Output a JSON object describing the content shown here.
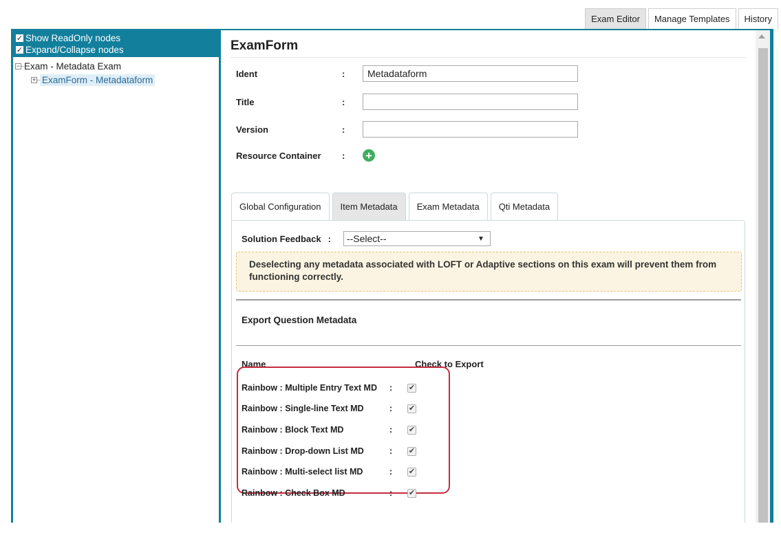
{
  "top_tabs": [
    {
      "label": "Exam Editor",
      "active": true
    },
    {
      "label": "Manage Templates",
      "active": false
    },
    {
      "label": "History",
      "active": false
    }
  ],
  "tree": {
    "options": [
      {
        "label": "Show ReadOnly nodes",
        "checked": true
      },
      {
        "label": "Expand/Collapse nodes",
        "checked": true
      }
    ],
    "nodes": [
      {
        "label": "Exam - Metadata Exam",
        "expander": "−"
      },
      {
        "label": "ExamForm - Metadataform",
        "expander": "+",
        "selected": true
      }
    ]
  },
  "form": {
    "title": "ExamForm",
    "fields": [
      {
        "label": "Ident",
        "value": "Metadataform"
      },
      {
        "label": "Title",
        "value": ""
      },
      {
        "label": "Version",
        "value": ""
      }
    ],
    "resource_container_label": "Resource Container",
    "colon": ":"
  },
  "sub_tabs": [
    {
      "label": "Global Configuration",
      "active": false
    },
    {
      "label": "Item Metadata",
      "active": true
    },
    {
      "label": "Exam Metadata",
      "active": false
    },
    {
      "label": "Qti Metadata",
      "active": false
    }
  ],
  "pane": {
    "solution_feedback_label": "Solution Feedback",
    "solution_feedback_value": "--Select--",
    "warning": "Deselecting any metadata associated with LOFT or Adaptive sections on this exam will prevent them from functioning correctly.",
    "export_title": "Export Question Metadata",
    "col_name": "Name",
    "col_check": "Check to Export",
    "rows": [
      {
        "name": "Rainbow : Multiple Entry Text MD",
        "checked": true
      },
      {
        "name": "Rainbow : Single-line Text MD",
        "checked": true
      },
      {
        "name": "Rainbow : Block Text MD",
        "checked": true
      },
      {
        "name": "Rainbow : Drop-down List MD",
        "checked": true
      },
      {
        "name": "Rainbow : Multi-select list MD",
        "checked": true
      },
      {
        "name": "Rainbow : Check Box MD",
        "checked": true
      }
    ]
  },
  "colors": {
    "frame": "#127f9c",
    "highlight": "#c42b3e",
    "add_icon": "#3fae5c",
    "warning_bg": "#fcf4e2"
  }
}
